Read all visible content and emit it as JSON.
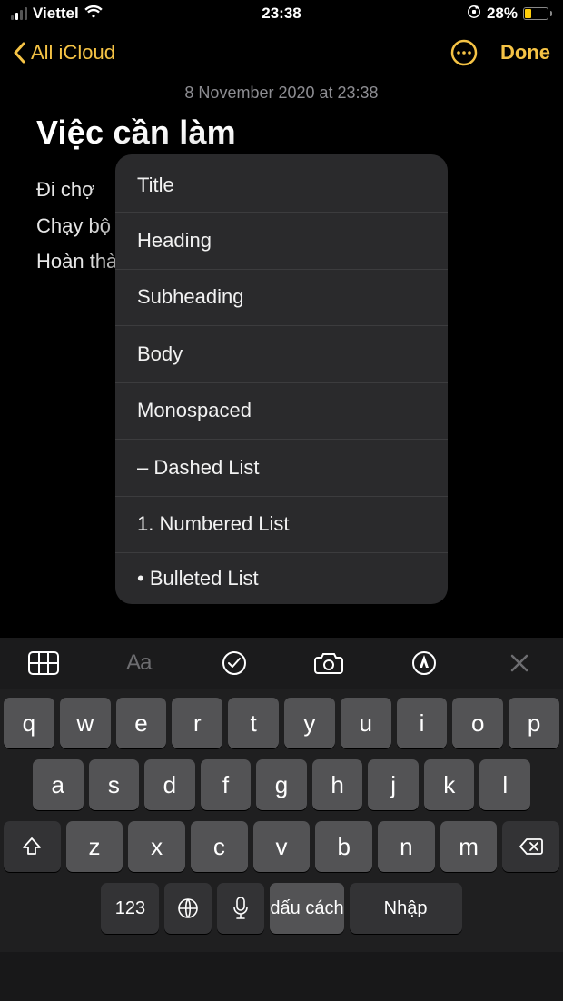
{
  "statusbar": {
    "carrier": "Viettel",
    "time": "23:38",
    "battery_pct": "28%"
  },
  "nav": {
    "back_label": "All iCloud",
    "done_label": "Done"
  },
  "note": {
    "timestamp": "8 November 2020 at 23:38",
    "title": "Việc cần làm",
    "lines": [
      "Đi chợ",
      "Chạy bộ",
      "Hoàn thà"
    ]
  },
  "format_menu": {
    "items": [
      "Title",
      "Heading",
      "Subheading",
      "Body",
      "Monospaced",
      "– Dashed List",
      "1. Numbered List",
      "• Bulleted List"
    ]
  },
  "toolbar": {
    "aa_label": "Aa"
  },
  "keyboard": {
    "row1": [
      "q",
      "w",
      "e",
      "r",
      "t",
      "y",
      "u",
      "i",
      "o",
      "p"
    ],
    "row2": [
      "a",
      "s",
      "d",
      "f",
      "g",
      "h",
      "j",
      "k",
      "l"
    ],
    "row3": [
      "z",
      "x",
      "c",
      "v",
      "b",
      "n",
      "m"
    ],
    "numbers_label": "123",
    "space_label": "dấu cách",
    "return_label": "Nhập"
  }
}
